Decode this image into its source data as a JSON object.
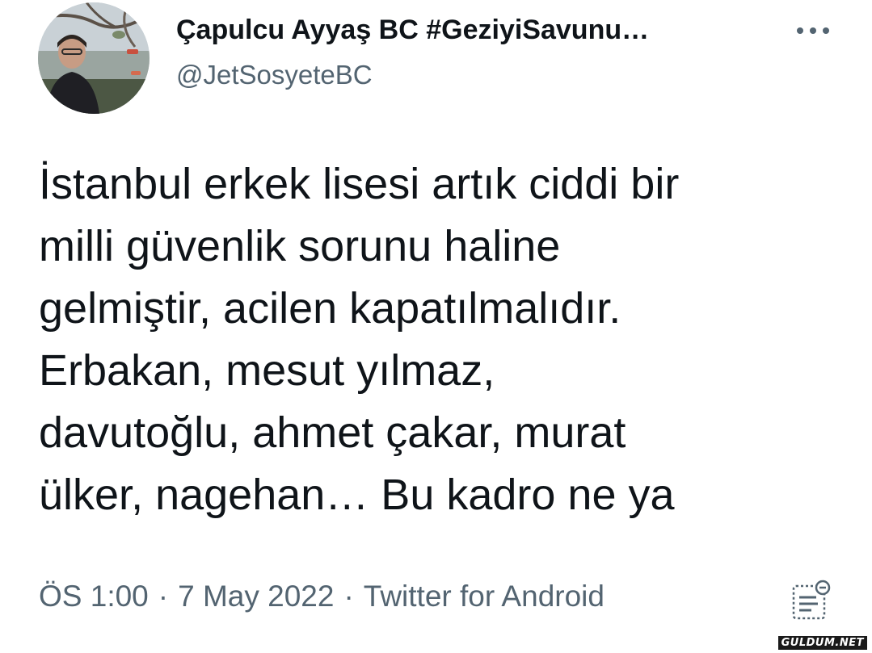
{
  "author": {
    "display_name": "Çapulcu Ayyaş BC #GeziyiSavunu…",
    "handle": "@JetSosyeteBC",
    "avatar_icon": "profile-photo"
  },
  "more_icon": "more-options-icon",
  "tweet": {
    "lines": [
      "İstanbul erkek lisesi artık ciddi bir",
      "milli güvenlik sorunu haline",
      "gelmiştir, acilen kapatılmalıdır.",
      "Erbakan, mesut yılmaz,",
      "davutoğlu, ahmet çakar, murat",
      "ülker, nagehan… Bu kadro ne ya"
    ]
  },
  "meta": {
    "time": "ÖS 1:00",
    "separator": "·",
    "date": "7 May 2022",
    "source": "Twitter for Android"
  },
  "analytics_icon": "view-tweet-analytics-icon",
  "watermark": "GULDUM.NET",
  "colors": {
    "text": "#0f1419",
    "secondary": "#536471",
    "background": "#ffffff"
  }
}
